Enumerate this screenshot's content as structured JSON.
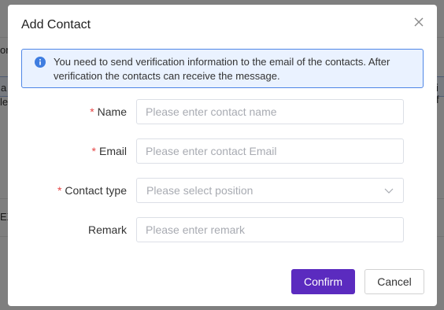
{
  "background": {
    "fragments": [
      "on",
      "a",
      "let",
      "EX",
      "i f"
    ]
  },
  "dialog": {
    "title": "Add Contact",
    "close_icon": "close-icon",
    "alert": {
      "icon": "info-icon",
      "text": "You need to send verification information to the email of the contacts. After verification the contacts can receive the message."
    },
    "fields": {
      "name": {
        "label": "Name",
        "required_mark": "*",
        "placeholder": "Please enter contact name",
        "value": ""
      },
      "email": {
        "label": "Email",
        "required_mark": "*",
        "placeholder": "Please enter contact Email",
        "value": ""
      },
      "contact_type": {
        "label": "Contact type",
        "required_mark": "*",
        "placeholder": "Please select position",
        "icon": "chevron-down-icon"
      },
      "remark": {
        "label": "Remark",
        "placeholder": "Please enter remark",
        "value": ""
      }
    },
    "buttons": {
      "confirm": "Confirm",
      "cancel": "Cancel"
    }
  },
  "colors": {
    "primary": "#5b2bbf",
    "info_border": "#4f86e6",
    "info_bg": "#eaf2ff",
    "required": "#e54545"
  }
}
